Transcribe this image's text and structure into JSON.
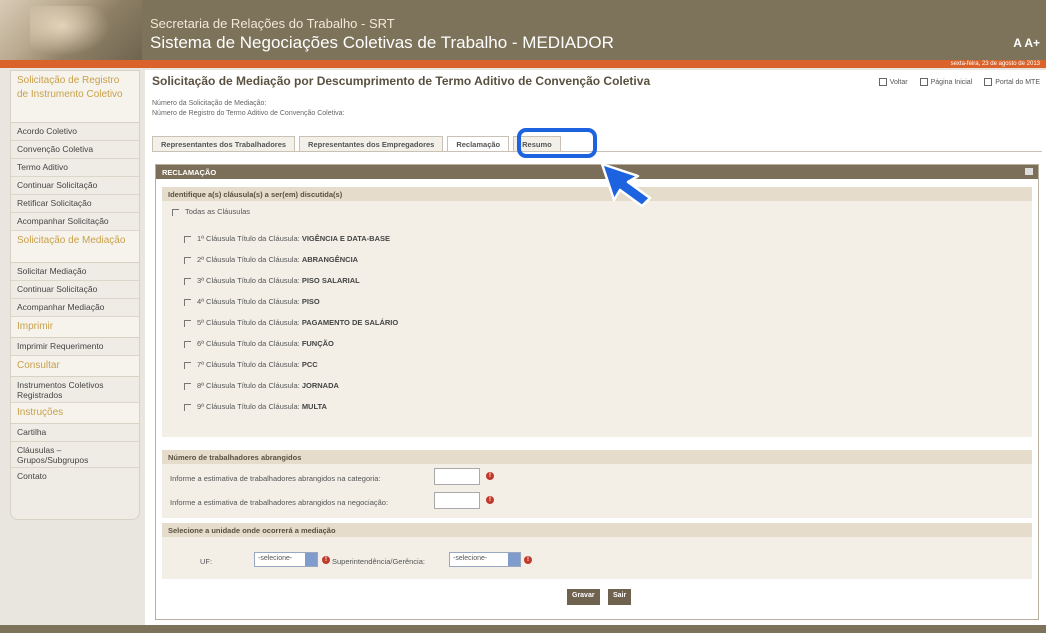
{
  "header": {
    "org": "Secretaria de Relações do Trabalho - SRT",
    "system": "Sistema de Negociações Coletivas de Trabalho - MEDIADOR",
    "font_buttons": "A A+",
    "date": "sexta-feira, 23 de agosto de 2013"
  },
  "sidebar": {
    "sections": [
      {
        "head": "Solicitação de Registro de Instrumento Coletivo",
        "items": [
          "Acordo Coletivo",
          "Convenção Coletiva",
          "Termo Aditivo",
          "Continuar Solicitação",
          "Retificar Solicitação",
          "Acompanhar Solicitação"
        ]
      },
      {
        "head": "Solicitação de Mediação",
        "items": [
          "Solicitar Mediação",
          "Continuar Solicitação",
          "Acompanhar Mediação"
        ]
      },
      {
        "head": "Imprimir",
        "items": [
          "Imprimir Requerimento"
        ]
      },
      {
        "head": "Consultar",
        "items": [
          "Instrumentos Coletivos Registrados"
        ]
      },
      {
        "head": "Instruções",
        "items": [
          "Cartilha",
          "Cláusulas – Grupos/Subgrupos",
          "Contato"
        ]
      }
    ]
  },
  "page": {
    "title": "Solicitação de Mediação por Descumprimento de Termo Aditivo de Convenção Coletiva",
    "links": [
      "Voltar",
      "Página Inicial",
      "Portal do MTE"
    ],
    "sub1": "Número da Solicitação de Mediação:",
    "sub2": "Número de Registro do Termo Aditivo de Convenção Coletiva:"
  },
  "tabs": [
    "Representantes dos Trabalhadores",
    "Representantes dos Empregadores",
    "Reclamação",
    "Resumo"
  ],
  "panel": {
    "title": "RECLAMAÇÃO",
    "clauses_header": "Identifique a(s) cláusula(s) a ser(em) discutida(s)",
    "all_clauses": "Todas as Cláusulas",
    "clauses": [
      {
        "num": "1ª Cláusula",
        "prefix": "Título da Cláusula:",
        "name": "VIGÊNCIA E DATA-BASE"
      },
      {
        "num": "2ª Cláusula",
        "prefix": "Título da Cláusula:",
        "name": "ABRANGÊNCIA"
      },
      {
        "num": "3ª Cláusula",
        "prefix": "Título da Cláusula:",
        "name": "PISO SALARIAL"
      },
      {
        "num": "4ª Cláusula",
        "prefix": "Título da Cláusula:",
        "name": "PISO"
      },
      {
        "num": "5ª Cláusula",
        "prefix": "Título da Cláusula:",
        "name": "PAGAMENTO DE SALÁRIO"
      },
      {
        "num": "6ª Cláusula",
        "prefix": "Título da Cláusula:",
        "name": "FUNÇÃO"
      },
      {
        "num": "7ª Cláusula",
        "prefix": "Título da Cláusula:",
        "name": "PCC"
      },
      {
        "num": "8ª Cláusula",
        "prefix": "Título da Cláusula:",
        "name": "JORNADA"
      },
      {
        "num": "9ª Cláusula",
        "prefix": "Título da Cláusula:",
        "name": "MULTA"
      }
    ],
    "workers_header": "Número de trabalhadores abrangidos",
    "workers_category": "Informe a estimativa de trabalhadores abrangidos na categoria:",
    "workers_negotiation": "Informe a estimativa de trabalhadores abrangidos na negociação:",
    "unit_header": "Selecione a unidade onde ocorrerá a mediação",
    "uf_label": "UF:",
    "uf_value": "-selecione-",
    "super_label": "Superintendência/Gerência:",
    "super_value": "-selecione-",
    "save": "Gravar",
    "exit": "Sair"
  },
  "colors": {
    "accent": "#1d63e0",
    "header": "#7d725a",
    "orange": "#d9632a"
  }
}
